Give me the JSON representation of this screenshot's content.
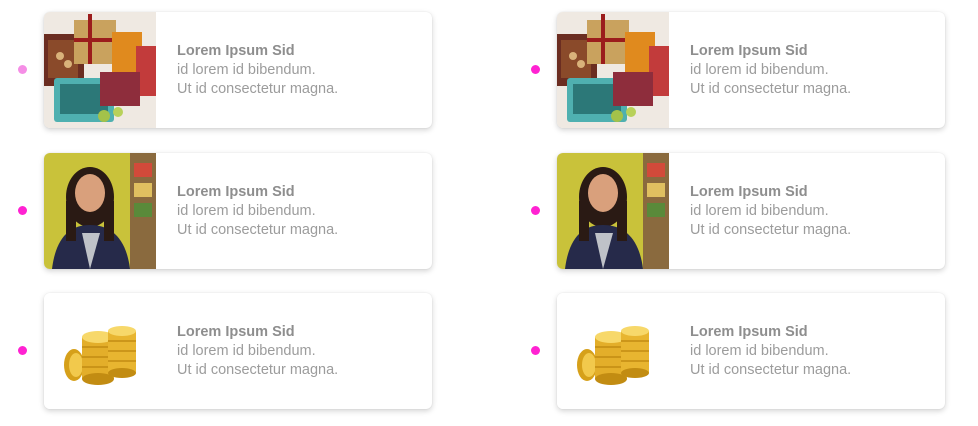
{
  "colors": {
    "dot_accent": "#ff22d2",
    "dot_light": "#f58ee6",
    "text": "#9c9c9c"
  },
  "columns": [
    {
      "items": [
        {
          "image": "gift-box-image",
          "title": "Lorem Ipsum Sid",
          "line1": "id lorem id bibendum.",
          "line2": "Ut id consectetur magna."
        },
        {
          "image": "woman-portrait-image",
          "title": "Lorem Ipsum Sid",
          "line1": "id lorem id bibendum.",
          "line2": "Ut id consectetur magna."
        },
        {
          "image": "gold-coins-image",
          "title": "Lorem Ipsum Sid",
          "line1": "id lorem id bibendum.",
          "line2": "Ut id consectetur magna."
        }
      ]
    },
    {
      "items": [
        {
          "image": "gift-box-image",
          "title": "Lorem Ipsum Sid",
          "line1": "id lorem id bibendum.",
          "line2": "Ut id consectetur magna."
        },
        {
          "image": "woman-portrait-image",
          "title": "Lorem Ipsum Sid",
          "line1": "id lorem id bibendum.",
          "line2": "Ut id consectetur magna."
        },
        {
          "image": "gold-coins-image",
          "title": "Lorem Ipsum Sid",
          "line1": "id lorem id bibendum.",
          "line2": "Ut id consectetur magna."
        }
      ]
    }
  ]
}
